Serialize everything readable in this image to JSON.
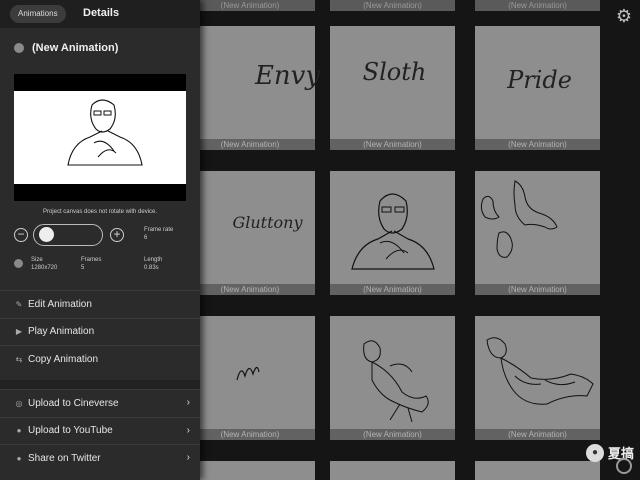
{
  "header": {
    "back_label": "Animations",
    "title": "Details"
  },
  "animation": {
    "name": "(New Animation)"
  },
  "note": "Project canvas does not rotate with device.",
  "controls": {
    "frame_rate_label": "Frame rate",
    "frame_rate_value": "6"
  },
  "stats": {
    "size_label": "Size",
    "size_value": "1280x720",
    "frames_label": "Frames",
    "frames_value": "5",
    "length_label": "Length",
    "length_value": "0.83s"
  },
  "menu": [
    {
      "label": "Edit Animation",
      "icon": "pencil-icon"
    },
    {
      "label": "Play Animation",
      "icon": "play-icon"
    },
    {
      "label": "Copy Animation",
      "icon": "copy-icon"
    }
  ],
  "share": [
    {
      "label": "Upload to Cineverse",
      "icon": "cineverse-icon"
    },
    {
      "label": "Upload to YouTube",
      "icon": "youtube-icon"
    },
    {
      "label": "Share on Twitter",
      "icon": "twitter-icon"
    }
  ],
  "gallery": {
    "caption": "(New Animation)",
    "tiles": [
      {
        "label": "Envy"
      },
      {
        "label": "Sloth"
      },
      {
        "label": "Pride"
      },
      {
        "label": "Gluttony"
      },
      {
        "label": ""
      },
      {
        "label": ""
      },
      {
        "label": ""
      },
      {
        "label": ""
      },
      {
        "label": ""
      }
    ]
  },
  "watermark": {
    "text": "夏搞"
  },
  "colors": {
    "panel": "#2b2b2b",
    "tile": "#8e8e8e",
    "caption_bar": "#626262",
    "background": "#151515"
  }
}
